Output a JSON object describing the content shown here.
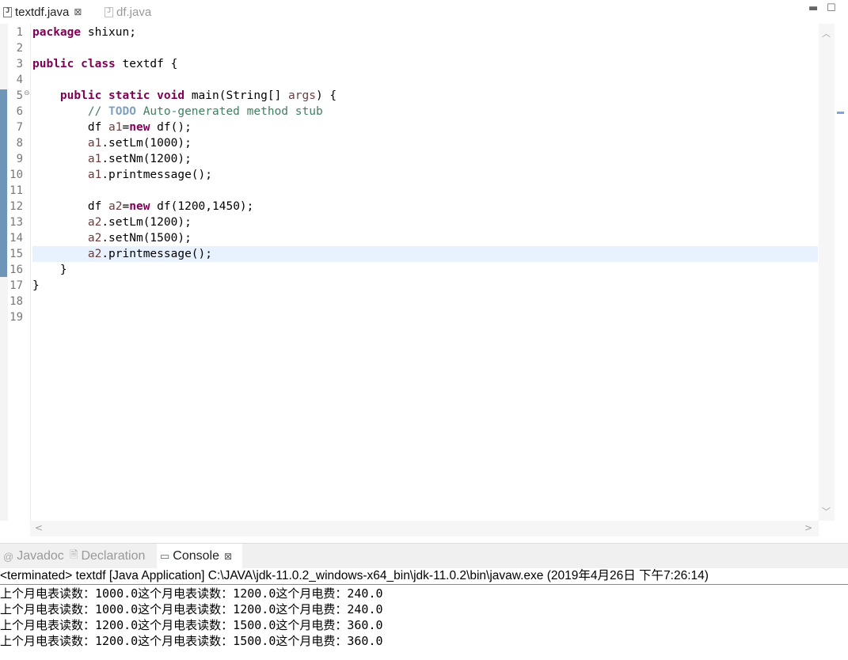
{
  "editor_tabs": [
    {
      "label": "textdf.java",
      "active": true
    },
    {
      "label": "df.java",
      "active": false
    }
  ],
  "code_lines": [
    {
      "n": "1",
      "tokens": [
        {
          "t": "package",
          "c": "kw"
        },
        {
          "t": " shixun;"
        }
      ]
    },
    {
      "n": "2",
      "tokens": []
    },
    {
      "n": "3",
      "tokens": [
        {
          "t": "public",
          "c": "kw"
        },
        {
          "t": " "
        },
        {
          "t": "class",
          "c": "kw"
        },
        {
          "t": " textdf {"
        }
      ]
    },
    {
      "n": "4",
      "tokens": []
    },
    {
      "n": "5",
      "fold": true,
      "tokens": [
        {
          "t": "    "
        },
        {
          "t": "public",
          "c": "kw"
        },
        {
          "t": " "
        },
        {
          "t": "static",
          "c": "kw"
        },
        {
          "t": " "
        },
        {
          "t": "void",
          "c": "kw"
        },
        {
          "t": " main(String[] "
        },
        {
          "t": "args",
          "c": "var"
        },
        {
          "t": ") {"
        }
      ]
    },
    {
      "n": "6",
      "tokens": [
        {
          "t": "        "
        },
        {
          "t": "// ",
          "c": "cm"
        },
        {
          "t": "TODO",
          "c": "todo"
        },
        {
          "t": " Auto-generated method stub",
          "c": "cm"
        }
      ]
    },
    {
      "n": "7",
      "tokens": [
        {
          "t": "        df "
        },
        {
          "t": "a1",
          "c": "var"
        },
        {
          "t": "="
        },
        {
          "t": "new",
          "c": "kw"
        },
        {
          "t": " df();"
        }
      ]
    },
    {
      "n": "8",
      "tokens": [
        {
          "t": "        "
        },
        {
          "t": "a1",
          "c": "var"
        },
        {
          "t": ".setLm(1000);"
        }
      ]
    },
    {
      "n": "9",
      "tokens": [
        {
          "t": "        "
        },
        {
          "t": "a1",
          "c": "var"
        },
        {
          "t": ".setNm(1200);"
        }
      ]
    },
    {
      "n": "10",
      "tokens": [
        {
          "t": "        "
        },
        {
          "t": "a1",
          "c": "var"
        },
        {
          "t": ".printmessage();"
        }
      ]
    },
    {
      "n": "11",
      "tokens": []
    },
    {
      "n": "12",
      "tokens": [
        {
          "t": "        df "
        },
        {
          "t": "a2",
          "c": "var"
        },
        {
          "t": "="
        },
        {
          "t": "new",
          "c": "kw"
        },
        {
          "t": " df(1200,1450);"
        }
      ]
    },
    {
      "n": "13",
      "tokens": [
        {
          "t": "        "
        },
        {
          "t": "a2",
          "c": "var"
        },
        {
          "t": ".setLm(1200);"
        }
      ]
    },
    {
      "n": "14",
      "tokens": [
        {
          "t": "        "
        },
        {
          "t": "a2",
          "c": "var"
        },
        {
          "t": ".setNm(1500);"
        }
      ]
    },
    {
      "n": "15",
      "current": true,
      "tokens": [
        {
          "t": "        "
        },
        {
          "t": "a2",
          "c": "var"
        },
        {
          "t": ".printmessage();"
        }
      ]
    },
    {
      "n": "16",
      "tokens": [
        {
          "t": "    }"
        }
      ]
    },
    {
      "n": "17",
      "tokens": [
        {
          "t": "}"
        }
      ]
    },
    {
      "n": "18",
      "tokens": []
    },
    {
      "n": "19",
      "tokens": []
    }
  ],
  "console": {
    "tabs": [
      {
        "label": "Javadoc",
        "icon": "@",
        "icon_name": "javadoc-icon"
      },
      {
        "label": "Declaration",
        "icon": "🗎",
        "icon_name": "declaration-icon"
      },
      {
        "label": "Console",
        "icon": "▭",
        "icon_name": "console-icon",
        "active": true
      }
    ],
    "terminated": "<terminated> textdf [Java Application] C:\\JAVA\\jdk-11.0.2_windows-x64_bin\\jdk-11.0.2\\bin\\javaw.exe (2019年4月26日 下午7:26:14)",
    "output": [
      "上个月电表读数：1000.0这个月电表读数：1200.0这个月电费：240.0",
      "上个月电表读数：1000.0这个月电表读数：1200.0这个月电费：240.0",
      "上个月电表读数：1200.0这个月电表读数：1500.0这个月电费：360.0",
      "上个月电表读数：1200.0这个月电表读数：1500.0这个月电费：360.0"
    ]
  },
  "colors": {
    "keyword": "#7f0055",
    "variable": "#6a3e3e",
    "comment": "#3f7f5f",
    "todo": "#7f9fbf",
    "current_line": "#e8f2fe"
  }
}
